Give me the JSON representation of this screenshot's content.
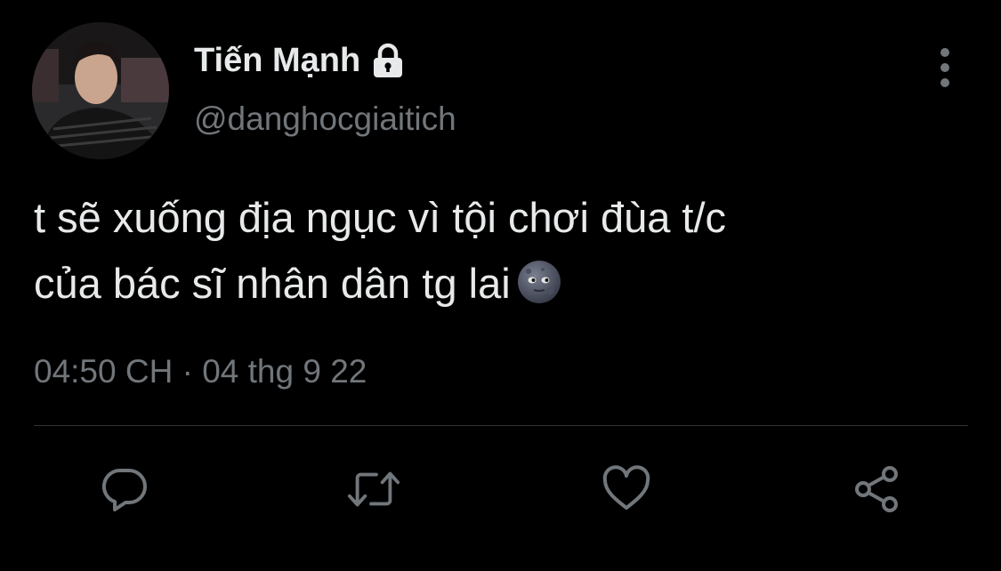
{
  "user": {
    "display_name": "Tiến Mạnh",
    "handle": "@danghocgiaitich",
    "protected": true
  },
  "tweet": {
    "line1": "t sẽ xuống địa ngục vì tội chơi đùa t/c",
    "line2": "của bác sĩ nhân dân tg lai",
    "emoji": "new-moon-face",
    "timestamp": "04:50 CH · 04 thg 9 22"
  },
  "actions": [
    "reply-icon",
    "retweet-icon",
    "like-icon",
    "share-icon"
  ],
  "colors": {
    "background": "#000000",
    "primary_text": "#e7e9ea",
    "secondary_text": "#71767b",
    "divider": "#2f3336"
  }
}
